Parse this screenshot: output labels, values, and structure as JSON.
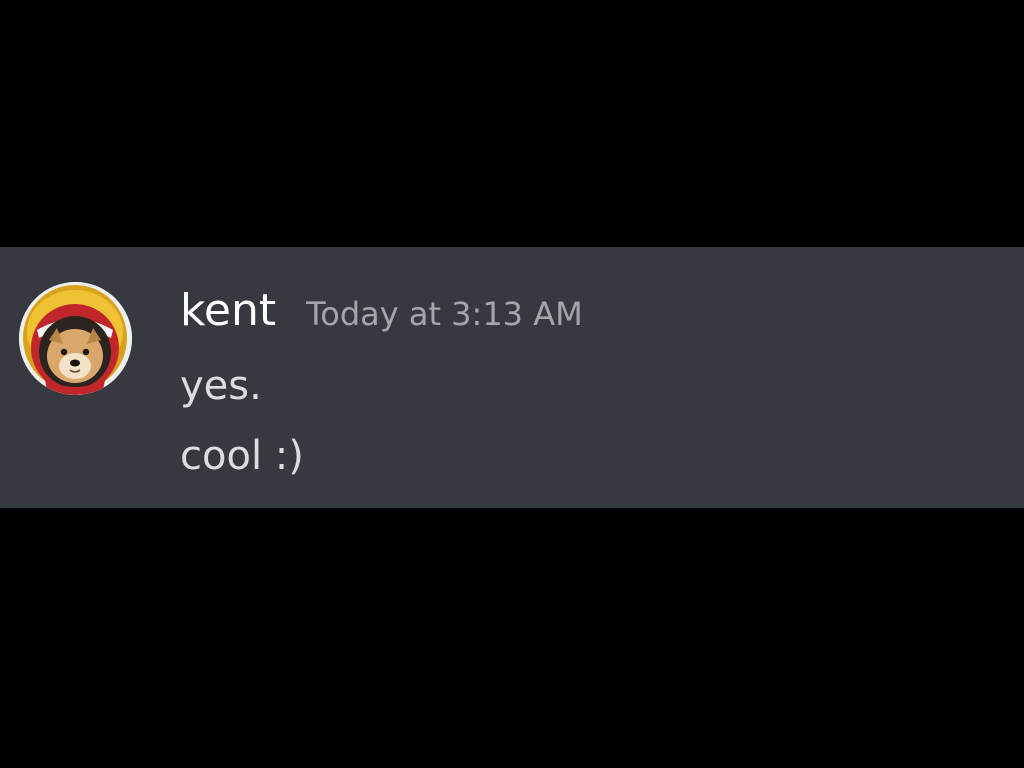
{
  "message": {
    "author": "kent",
    "timestamp": "Today at 3:13 AM",
    "lines": [
      "yes.",
      "cool :)"
    ],
    "avatar_icon": "dog-astronaut-helmet-icon"
  },
  "colors": {
    "background": "#000000",
    "message_background": "#36393f",
    "username": "#ffffff",
    "timestamp": "#a3a6aa",
    "text": "#dcddde"
  }
}
